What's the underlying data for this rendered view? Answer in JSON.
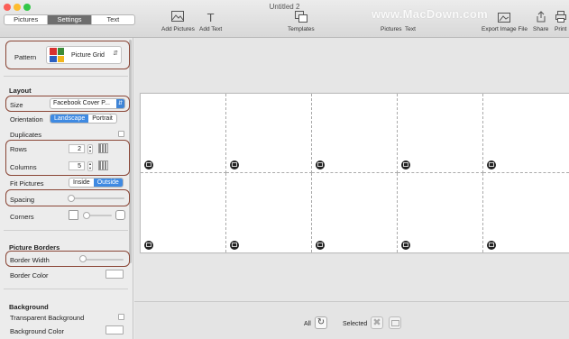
{
  "window": {
    "title": "Untitled 2"
  },
  "tabs": [
    {
      "label": "Pictures",
      "selected": false
    },
    {
      "label": "Settings",
      "selected": true
    },
    {
      "label": "Text",
      "selected": false
    }
  ],
  "toolbar": {
    "add_pictures": "Add Pictures",
    "add_text": "Add Text",
    "templates": "Templates",
    "pictures": "Pictures",
    "text": "Text",
    "export": "Export Image File",
    "share": "Share",
    "print": "Print"
  },
  "watermark": "www.MacDown.com",
  "sidebar": {
    "pattern_label": "Pattern",
    "pattern_value": "Picture Grid",
    "layout_title": "Layout",
    "size_label": "Size",
    "size_value": "Facebook Cover P...",
    "orientation_label": "Orientation",
    "orientation_options": [
      "Landscape",
      "Portrait"
    ],
    "orientation_selected": "Landscape",
    "duplicates_label": "Duplicates",
    "rows_label": "Rows",
    "rows_value": "2",
    "columns_label": "Columns",
    "columns_value": "5",
    "fit_label": "Fit Pictures",
    "fit_options": [
      "Inside",
      "Outside"
    ],
    "fit_selected": "Outside",
    "spacing_label": "Spacing",
    "corners_label": "Corners",
    "borders_title": "Picture Borders",
    "border_width_label": "Border Width",
    "border_color_label": "Border Color",
    "background_title": "Background",
    "transparent_label": "Transparent Background",
    "bg_color_label": "Background Color"
  },
  "bottom": {
    "all_label": "All",
    "selected_label": "Selected"
  },
  "colors": {
    "highlight": "#8a4636",
    "accent": "#3f8ae2",
    "selected_tab": "#6e6e6e"
  },
  "grid": {
    "rows": 2,
    "columns": 5
  }
}
